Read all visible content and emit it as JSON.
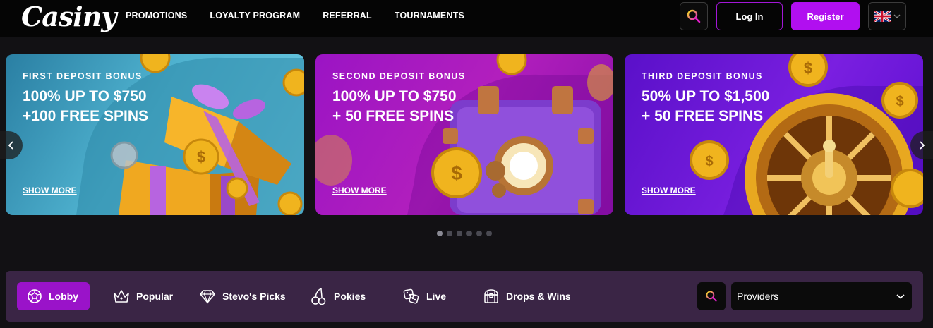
{
  "header": {
    "logo": "Casiny",
    "nav": [
      "PROMOTIONS",
      "LOYALTY PROGRAM",
      "REFERRAL",
      "TOURNAMENTS"
    ],
    "login_label": "Log In",
    "register_label": "Register",
    "language_icon": "uk-flag-icon"
  },
  "carousel": {
    "cards": [
      {
        "kicker": "FIRST DEPOSIT BONUS",
        "headline": "100% UP TO $750\n+100 FREE SPINS",
        "link": "SHOW MORE"
      },
      {
        "kicker": "SECOND DEPOSIT BONUS",
        "headline": "100% UP TO $750\n+ 50 FREE SPINS",
        "link": "SHOW MORE"
      },
      {
        "kicker": "THIRD DEPOSIT BONUS",
        "headline": "50% UP TO $1,500\n+ 50 FREE SPINS",
        "link": "SHOW MORE"
      }
    ],
    "prev_icon": "chevron-left-icon",
    "next_icon": "chevron-right-icon",
    "dot_count": 6,
    "active_dot": 1
  },
  "categories": {
    "items": [
      {
        "label": "Lobby",
        "icon": "soccer-ball-icon"
      },
      {
        "label": "Popular",
        "icon": "crown-icon"
      },
      {
        "label": "Stevo's Picks",
        "icon": "diamond-icon"
      },
      {
        "label": "Pokies",
        "icon": "cherries-icon"
      },
      {
        "label": "Live",
        "icon": "dice-icon"
      },
      {
        "label": "Drops & Wins",
        "icon": "treasure-chest-icon"
      }
    ],
    "active": "Lobby",
    "providers_label": "Providers"
  },
  "colors": {
    "accent": "#b10ff0",
    "catbar_bg": "#3a2545",
    "header_bg": "#050505",
    "page_bg": "#121114"
  }
}
